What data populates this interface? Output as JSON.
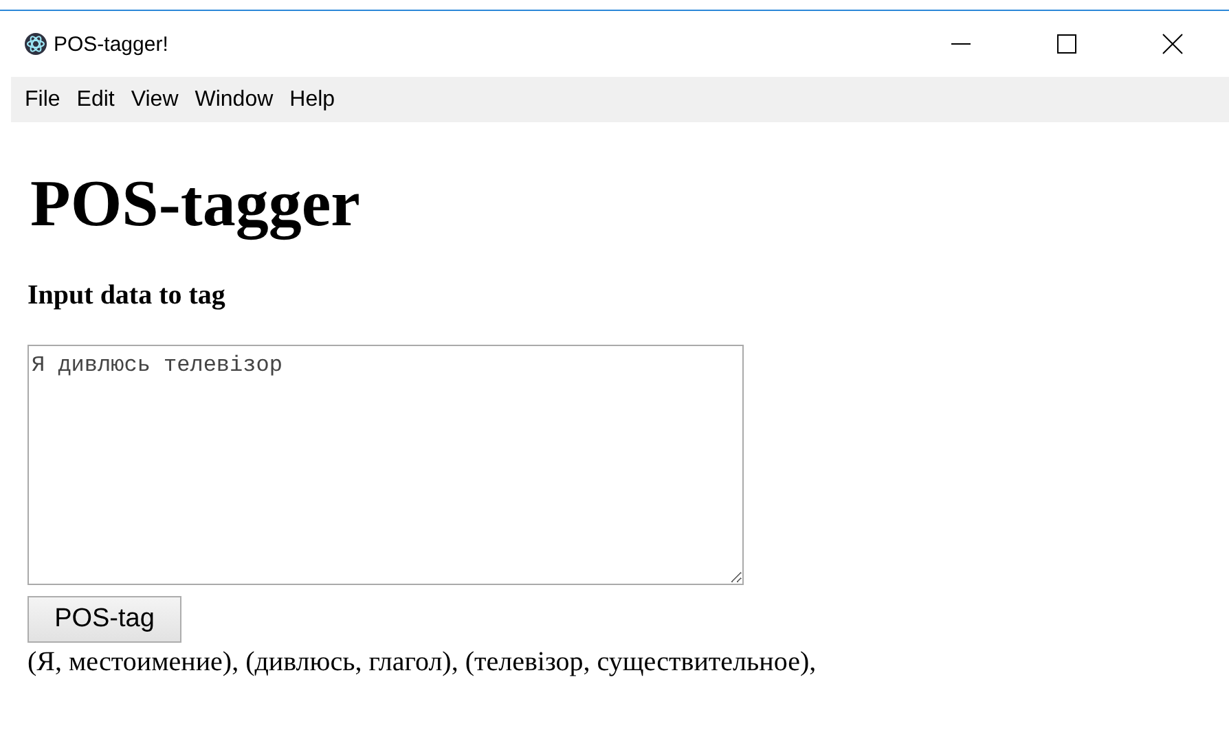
{
  "window": {
    "title": "POS-tagger!",
    "controls": [
      {
        "kind": "minimize"
      },
      {
        "kind": "maximize"
      },
      {
        "kind": "close"
      }
    ]
  },
  "menu": [
    "File",
    "Edit",
    "View",
    "Window",
    "Help"
  ],
  "heading": "POS-tagger",
  "input": {
    "label": "Input data to tag",
    "value": "Я дивлюсь телевізор"
  },
  "button": "POS-tag",
  "result": "(Я, местоимение), (дивлюсь, глагол), (телевізор, существительное),"
}
